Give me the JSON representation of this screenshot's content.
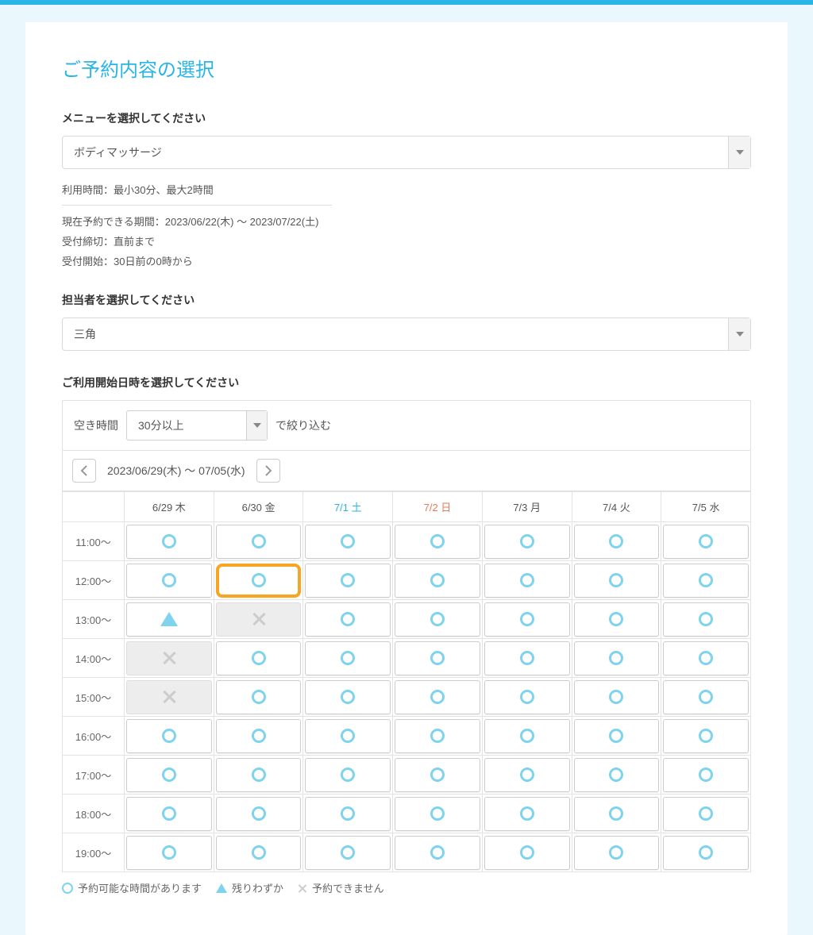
{
  "title": "ご予約内容の選択",
  "menu": {
    "label": "メニューを選択してください",
    "selected": "ボディマッサージ",
    "time_line": "利用時間：最小30分、最大2時間",
    "period": "現在予約できる期間：2023/06/22(木) ～ 2023/07/22(土)",
    "deadline": "受付締切：直前まで",
    "start": "受付開始：30日前の0時から"
  },
  "staff": {
    "label": "担当者を選択してください",
    "selected": "三角"
  },
  "datetime": {
    "label": "ご利用開始日時を選択してください",
    "filter_prefix": "空き時間",
    "filter_value": "30分以上",
    "filter_suffix": "で絞り込む",
    "range": "2023/06/29(木) ～ 07/05(水)",
    "days": [
      {
        "label": "6/29 木",
        "cls": ""
      },
      {
        "label": "6/30 金",
        "cls": ""
      },
      {
        "label": "7/1 土",
        "cls": "sat"
      },
      {
        "label": "7/2 日",
        "cls": "sun"
      },
      {
        "label": "7/3 月",
        "cls": ""
      },
      {
        "label": "7/4 火",
        "cls": ""
      },
      {
        "label": "7/5 水",
        "cls": ""
      }
    ],
    "rows": [
      {
        "time": "11:00～",
        "cells": [
          "o",
          "o",
          "o",
          "o",
          "o",
          "o",
          "o"
        ]
      },
      {
        "time": "12:00～",
        "cells": [
          "o",
          "o-hl",
          "o",
          "o",
          "o",
          "o",
          "o"
        ]
      },
      {
        "time": "13:00～",
        "cells": [
          "t",
          "x",
          "o",
          "o",
          "o",
          "o",
          "o"
        ]
      },
      {
        "time": "14:00～",
        "cells": [
          "x",
          "o",
          "o",
          "o",
          "o",
          "o",
          "o"
        ]
      },
      {
        "time": "15:00～",
        "cells": [
          "x",
          "o",
          "o",
          "o",
          "o",
          "o",
          "o"
        ]
      },
      {
        "time": "16:00～",
        "cells": [
          "o",
          "o",
          "o",
          "o",
          "o",
          "o",
          "o"
        ]
      },
      {
        "time": "17:00～",
        "cells": [
          "o",
          "o",
          "o",
          "o",
          "o",
          "o",
          "o"
        ]
      },
      {
        "time": "18:00～",
        "cells": [
          "o",
          "o",
          "o",
          "o",
          "o",
          "o",
          "o"
        ]
      },
      {
        "time": "19:00～",
        "cells": [
          "o",
          "o",
          "o",
          "o",
          "o",
          "o",
          "o"
        ]
      }
    ]
  },
  "legend": {
    "available": "予約可能な時間があります",
    "few": "残りわずか",
    "unavailable": "予約できません"
  }
}
